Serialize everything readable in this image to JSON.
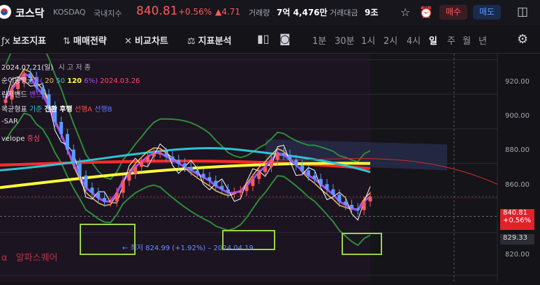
{
  "header": {
    "name": "코스닥",
    "code": "KOSDAQ",
    "category": "국내지수",
    "price": "840.81",
    "change_pct": "+0.56%",
    "change_abs": "▲4.71",
    "volume_label": "거래량",
    "volume_value": "7억 4,476만",
    "amount_label": "거래대금",
    "amount_value": "9조",
    "buy_label": "매수",
    "sell_label": "매도"
  },
  "toolbar": {
    "tools": [
      {
        "icon": "ƒx",
        "label": "보조지표"
      },
      {
        "icon": "⇅",
        "label": "매매전략"
      },
      {
        "icon": "✕",
        "label": "비교차트"
      },
      {
        "icon": "⚖",
        "label": "지표분석"
      }
    ],
    "periods": [
      "1분",
      "30분",
      "1시",
      "2시",
      "4시",
      "일",
      "주",
      "월",
      "년"
    ],
    "active_period": "일"
  },
  "overlay": {
    "date": "2024.07.21(일)",
    "ohlc": "시  고  저  종",
    "ma_label": "순이동평균",
    "ma_tail": "주(",
    "ma_periods": [
      "20",
      "50",
      "120"
    ],
    "ma_pct": "6%)",
    "ma_date": "2024.03.26",
    "bb_label": "린저밴드",
    "bb_tail": "밴드",
    "ichimoku_label": "목균형표",
    "ichimoku_items": [
      "기준",
      "전환",
      "후행",
      "선행A",
      "선행B"
    ],
    "sar_label": "-SAR",
    "envelope_label": "velope",
    "envelope_tail": "중심",
    "low_note": "최저 824.99 (+1.92%) – 2024.04.19",
    "watermark": "알파스퀘어"
  },
  "axis": {
    "ticks": [
      "920.00",
      "900.00",
      "880.00",
      "860.00",
      "820.00"
    ],
    "price_tag": "840.81",
    "price_pct": "+0.56%",
    "line_tag": "829.33"
  },
  "colors": {
    "up": "#ff5a5a",
    "down": "#5b9bff",
    "ma20": "#f2c14e",
    "ma50": "#2ec4d6",
    "ma120": "#ffff3a",
    "ma_long": "#ff2b2b",
    "bollinger": "#2e8b3a",
    "purple": "#a44bff",
    "highlight": "#9bd24a"
  },
  "chart_data": {
    "type": "line",
    "ylim": [
      815,
      935
    ],
    "closes": [
      897,
      903,
      907,
      912,
      910,
      904,
      900,
      893,
      884,
      877,
      868,
      860,
      853,
      846,
      843,
      840,
      838,
      838,
      843,
      850,
      854,
      858,
      861,
      864,
      866,
      866,
      864,
      862,
      860,
      858,
      856,
      854,
      852,
      850,
      847,
      845,
      843,
      843,
      844,
      847,
      851,
      855,
      858,
      862,
      866,
      865,
      862,
      859,
      856,
      853,
      851,
      848,
      845,
      842,
      838,
      836,
      834,
      833,
      838,
      840.81
    ]
  }
}
